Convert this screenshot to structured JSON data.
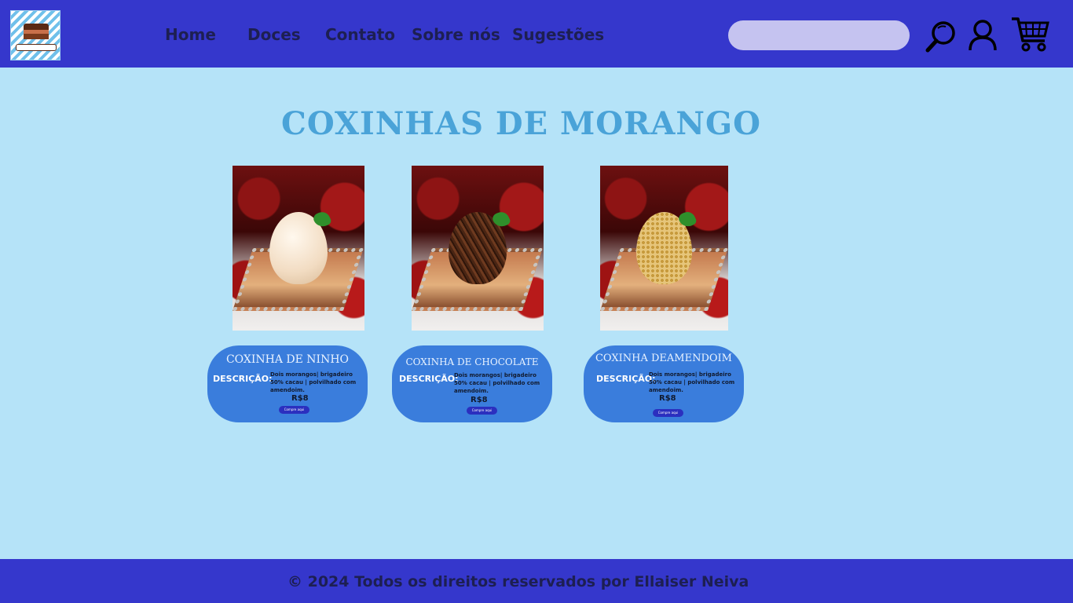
{
  "header": {
    "nav": [
      "Home",
      "Doces",
      "Contato",
      "Sobre nós",
      "Sugestões"
    ],
    "search": {
      "value": "",
      "placeholder": ""
    },
    "icons": [
      "search-icon",
      "user-icon",
      "cart-icon"
    ],
    "logo_icon": "cake-logo"
  },
  "main": {
    "title": "COXINHAS DE MORANGO",
    "products": [
      {
        "title": "COXINHA DE NINHO",
        "desc_label": "DESCRIÇÃO:",
        "desc": "Dois morangos| brigadeiro 50% cacau | polvilhado com amendoim.",
        "price": "R$8",
        "button": "Compre aqui",
        "image": "white-coated-strawberry"
      },
      {
        "title": "COXINHA DE CHOCOLATE",
        "desc_label": "DESCRIÇÃO:",
        "desc": "Dois morangos| brigadeiro 50% cacau | polvilhado com amendoim.",
        "price": "R$8",
        "button": "Compre aqui",
        "image": "chocolate-sprinkled-strawberry"
      },
      {
        "title": "COXINHA DEAMENDOIM",
        "desc_label": "DESCRIÇÃO:",
        "desc": "Dois morangos| brigadeiro 50% cacau | polvilhado com amendoim.",
        "price": "R$8",
        "button": "Compre aqui",
        "image": "peanut-coated-strawberry"
      }
    ]
  },
  "footer": {
    "text": "© 2024 Todos os  direitos reservados por  Ellaiser Neiva"
  },
  "colors": {
    "header_bg": "#3537cc",
    "page_bg": "#b5e3f8",
    "card_bg": "#3a7ddc",
    "title_color": "#4aa3d8",
    "search_bg": "#c5c3f0"
  }
}
